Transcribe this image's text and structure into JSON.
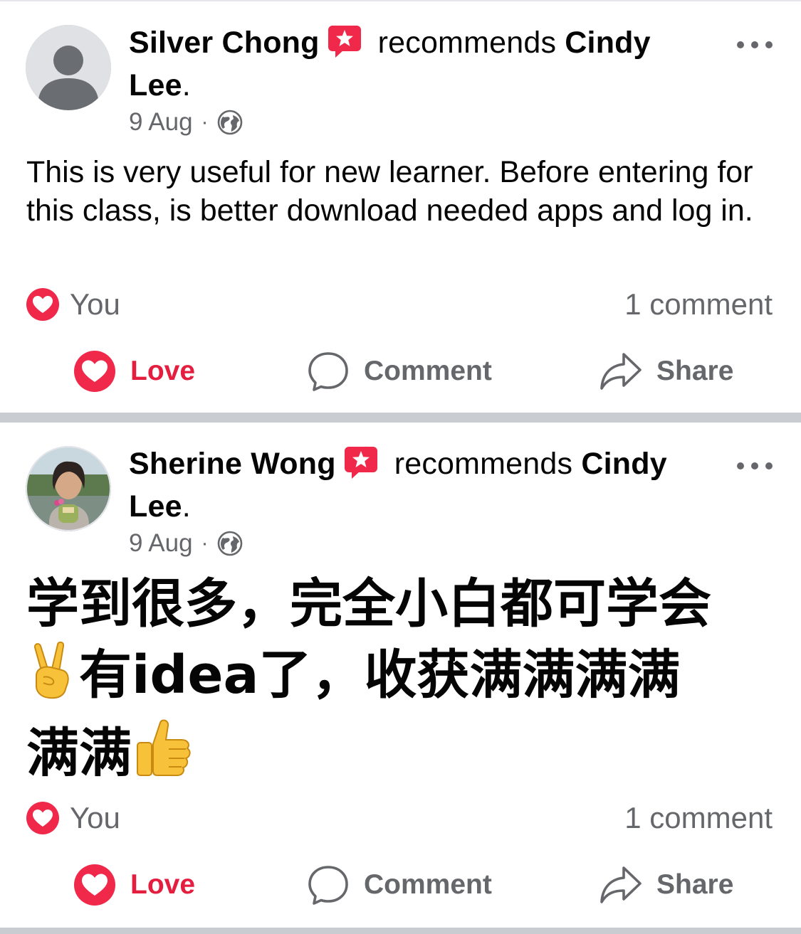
{
  "posts": [
    {
      "author": "Silver Chong",
      "verb": "recommends",
      "target": "Cindy Lee",
      "period": ".",
      "date": "9 Aug",
      "separator": "·",
      "body": "This is very useful for new learner. Before entering for this class, is better download needed apps and log in.",
      "reactors": "You",
      "comments": "1 comment",
      "actions": {
        "love": "Love",
        "comment": "Comment",
        "share": "Share"
      }
    },
    {
      "author": "Sherine Wong",
      "verb": "recommends",
      "target": "Cindy Lee",
      "period": ".",
      "date": "9 Aug",
      "separator": "·",
      "body_line1": "学到很多，完全小白都可学会",
      "body_line2_text": "有idea了，收获满满满满",
      "body_line3_text": "满满",
      "body_emoji_1": "✌️",
      "body_emoji_2": "👍",
      "reactors": "You",
      "comments": "1 comment",
      "actions": {
        "love": "Love",
        "comment": "Comment",
        "share": "Share"
      }
    }
  ],
  "colors": {
    "love_red": "#e41e3f",
    "muted": "#65676b",
    "badge_pink": "#f0284a",
    "separator": "#c9ccd1"
  },
  "icons": [
    "person-avatar-icon",
    "recommend-badge-icon",
    "globe-icon",
    "more-icon",
    "love-reaction-icon",
    "comment-icon",
    "share-icon",
    "victory-hand-emoji",
    "thumbs-up-emoji"
  ]
}
